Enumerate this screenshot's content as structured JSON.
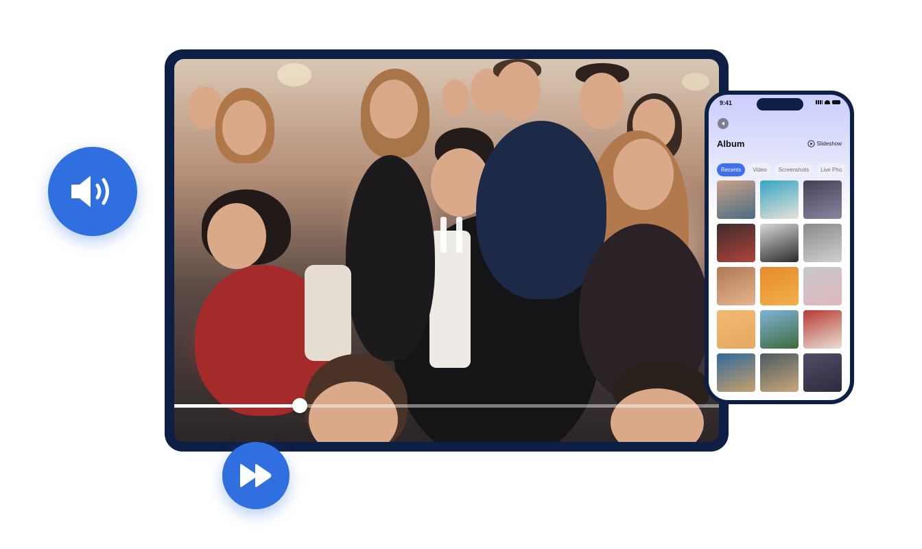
{
  "video_player": {
    "state": "playing",
    "controls": [
      "pause-icon"
    ],
    "progress": 0.23
  },
  "floating_buttons": {
    "volume_icon": "speaker-volume-icon",
    "forward_icon": "fast-forward-icon",
    "color": "#2f6fe0"
  },
  "phone": {
    "status_time": "9:41",
    "back_icon": "chevron-left-icon",
    "title": "Album",
    "slideshow_label": "Slideshow",
    "tabs": [
      {
        "label": "Recents",
        "active": true
      },
      {
        "label": "Video",
        "active": false
      },
      {
        "label": "Screenshots",
        "active": false
      },
      {
        "label": "Live Pho",
        "active": false
      }
    ],
    "thumbnails": [
      {
        "colors": [
          "#c9a189",
          "#4c6b82"
        ]
      },
      {
        "colors": [
          "#33a6c6",
          "#e8e2d6"
        ]
      },
      {
        "colors": [
          "#454058",
          "#8a86a0"
        ]
      },
      {
        "colors": [
          "#3d2c2d",
          "#b0443a"
        ]
      },
      {
        "colors": [
          "#d8d8d8",
          "#2a2a2a"
        ]
      },
      {
        "colors": [
          "#8a8a8a",
          "#d0d0d0"
        ]
      },
      {
        "colors": [
          "#b07a52",
          "#e7b38f"
        ]
      },
      {
        "colors": [
          "#e68a2c",
          "#f2b04a"
        ]
      },
      {
        "colors": [
          "#c8c8c8",
          "#e0b8bf"
        ]
      },
      {
        "colors": [
          "#f2b874",
          "#e8a95e"
        ]
      },
      {
        "colors": [
          "#7fb3da",
          "#3f6a3a"
        ]
      },
      {
        "colors": [
          "#b73a34",
          "#e9e1d6"
        ]
      },
      {
        "colors": [
          "#2f6a9c",
          "#c99f69"
        ]
      },
      {
        "colors": [
          "#4a5a62",
          "#c9a77a"
        ]
      },
      {
        "colors": [
          "#514d6a",
          "#2c2b3a"
        ]
      }
    ],
    "accent": "#3e6ff0"
  },
  "frame_color": "#0d1f45"
}
